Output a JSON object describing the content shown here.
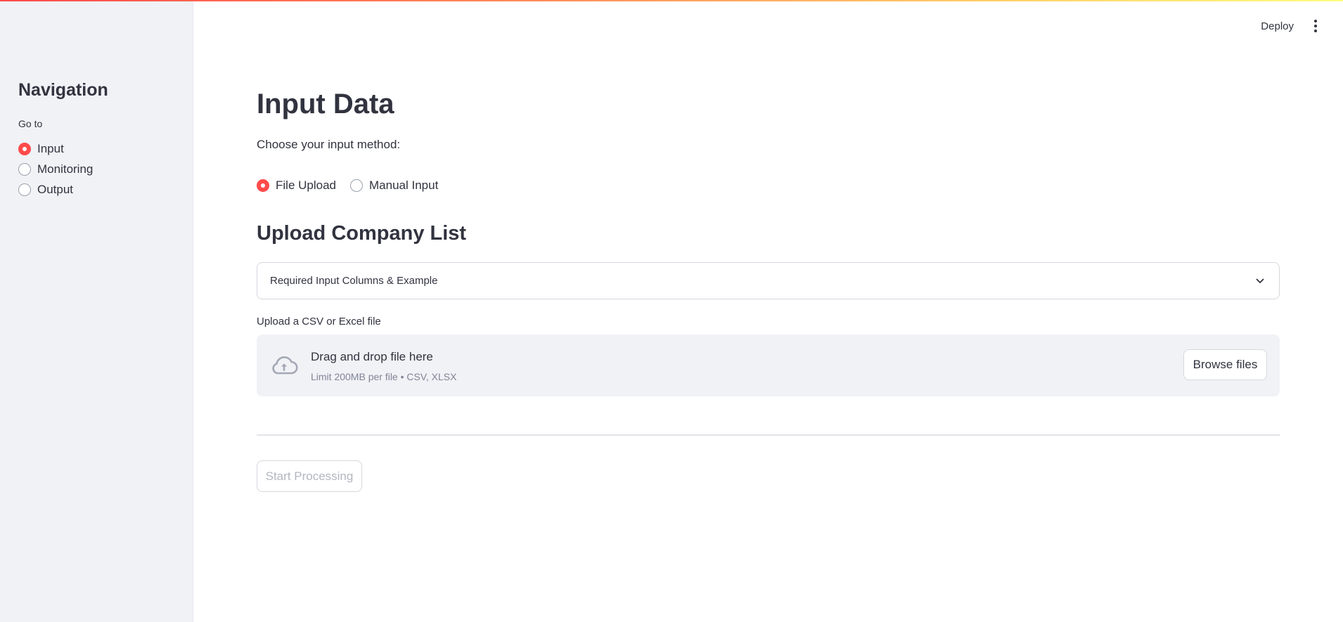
{
  "header": {
    "deploy_label": "Deploy",
    "menu_icon": "kebab-vertical-icon"
  },
  "sidebar": {
    "title": "Navigation",
    "radio_group_label": "Go to",
    "items": [
      {
        "label": "Input",
        "selected": true
      },
      {
        "label": "Monitoring",
        "selected": false
      },
      {
        "label": "Output",
        "selected": false
      }
    ]
  },
  "main": {
    "title": "Input Data",
    "method_prompt": "Choose your input method:",
    "methods": [
      {
        "label": "File Upload",
        "selected": true
      },
      {
        "label": "Manual Input",
        "selected": false
      }
    ],
    "section_title": "Upload Company List",
    "expander": {
      "label": "Required Input Columns & Example",
      "icon": "chevron-down-icon"
    },
    "uploader": {
      "label": "Upload a CSV or Excel file",
      "drop_title": "Drag and drop file here",
      "drop_hint": "Limit 200MB per file • CSV, XLSX",
      "browse_label": "Browse files",
      "icon": "cloud-upload-icon"
    },
    "start_label": "Start Processing"
  },
  "colors": {
    "accent": "#ff4b4b",
    "sidebar_bg": "#f0f2f6",
    "text": "#31333f",
    "muted_text": "#808495",
    "disabled_text": "#b4b6bf"
  }
}
